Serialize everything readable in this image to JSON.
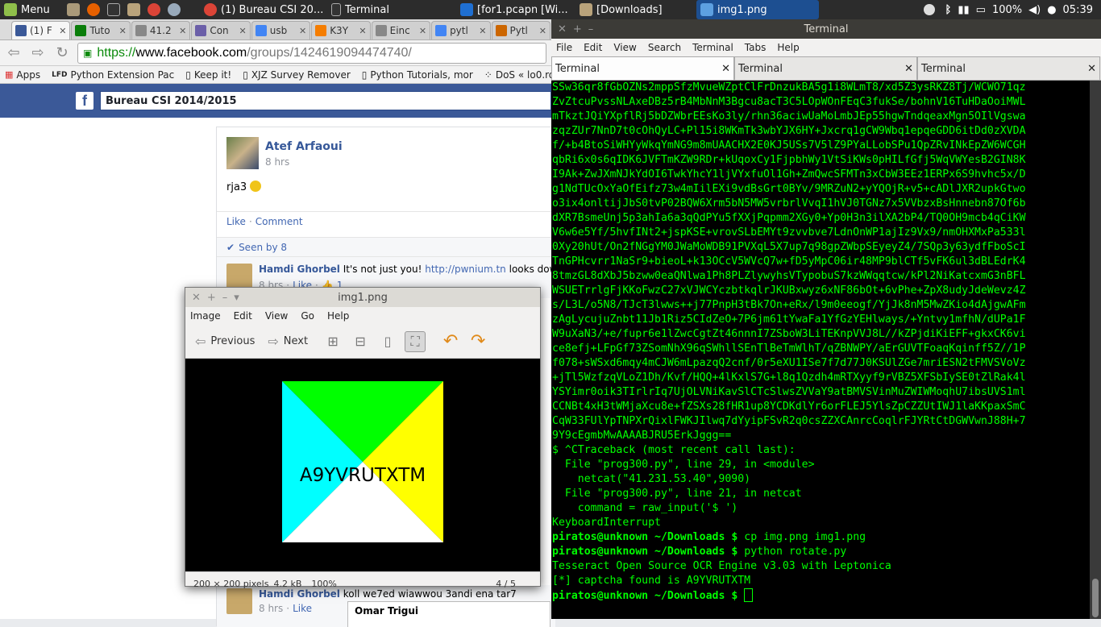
{
  "panel": {
    "menu_label": "Menu",
    "items": [
      {
        "label": "(1) Bureau CSI 20...",
        "icon": "chrome-icon"
      },
      {
        "label": "Terminal",
        "icon": "terminal-icon"
      },
      {
        "label": "[for1.pcapng",
        "icon": "wireshark-icon"
      },
      {
        "label": "[Wi...",
        "icon": "window-icon"
      },
      {
        "label": "[Downloads]",
        "icon": "folder-icon"
      },
      {
        "label": "img1.png",
        "icon": "image-viewer-icon"
      }
    ],
    "battery": "100%",
    "clock": "05:39"
  },
  "browser": {
    "tabs": [
      {
        "label": "(1) F",
        "color": "#3b5998"
      },
      {
        "label": "Tuto",
        "color": "#0a7d0a"
      },
      {
        "label": "41.2",
        "color": "#888888"
      },
      {
        "label": "Con",
        "color": "#6b5fa8"
      },
      {
        "label": "usb",
        "color": "#4285f4"
      },
      {
        "label": "K3Y",
        "color": "#f57d00"
      },
      {
        "label": "Einc",
        "color": "#888888"
      },
      {
        "label": "pytl",
        "color": "#4285f4"
      },
      {
        "label": "Pytl",
        "color": "#cc6600"
      }
    ],
    "url": {
      "scheme": "https://",
      "host": "www.facebook.com",
      "path": "/groups/1424619094474740/"
    },
    "bookmarks": [
      "Apps",
      "Python Extension Pac",
      "Keep it!",
      "XJZ Survey Remover",
      "Python Tutorials, mor",
      "DoS « lo0.ro"
    ],
    "group_title": "Bureau CSI 2014/2015"
  },
  "feed": {
    "post": {
      "author": "Atef Arfaoui",
      "time": "8 hrs",
      "text": "rja3",
      "like": "Like",
      "comment": "Comment",
      "seen": "Seen by 8"
    },
    "comments": [
      {
        "author": "Hamdi Ghorbel",
        "text": "It's not just you!",
        "link": "http://pwnium.tn",
        "tail": "looks down from he",
        "time": "8 hrs",
        "like": "Like",
        "likes": "1"
      },
      {
        "author": "Hamdi Ghorbel",
        "text": "koll we7ed wiawwou 3andi ena tar7",
        "time": "8 hrs",
        "like": "Like"
      }
    ],
    "chat_name": "Omar Trigui"
  },
  "terminal": {
    "title": "Terminal",
    "menu": [
      "File",
      "Edit",
      "View",
      "Search",
      "Terminal",
      "Tabs",
      "Help"
    ],
    "tabs": [
      "Terminal",
      "Terminal",
      "Terminal"
    ],
    "lines": [
      "SSw36qr8fGbOZNs2mppSfzMvueWZptClFrDnzukBA5g1i8WLmT8/xd5Z3ysRKZ8Tj/WCWO71qz",
      "ZvZtcuPvssNLAxeDBz5rB4MbNnM3Bgcu8acT3C5LOpWOnFEqC3fukSe/bohnV16TuHDaOoiMWL",
      "mTkztJQiYXpflRj5bDZWbrEEsKo3ly/rhn36aciwUaMoLmbJEp55hgwTndqeaxMgn5OIlVgswa",
      "zqzZUr7NnD7t0cOhQyLC+Pl15i8WKmTk3wbYJX6HY+Jxcrq1gCW9Wbq1epqeGDD6itDd0zXVDA",
      "f/+b4BtoSiWHYyWkqYmNG9m8mUAACHX2E0KJ5USs7V5lZ9PYaLLobSPu1QpZRvINkEpZW6WCGH",
      "qbRi6x0s6qIDK6JVFTmKZW9RDr+kUqoxCy1FjpbhWy1VtSiKWs0pHILfGfj5WqVWYesB2GIN8K",
      "I9Ak+ZwJXmNJkYdOI6TwkYhcY1ljVYxfuOl1Gh+ZmQwcSFMTn3xCbW3EEz1ERPx6S9hvhc5x/D",
      "g1NdTUcOxYaOfEifz73w4mIilEXi9vdBsGrt0BYv/9MRZuN2+yYQOjR+v5+cADlJXR2upkGtwo",
      "o3ix4onltijJbS0tvP02BQW6Xrm5bN5MW5vrbrlVvqI1hVJ0TGNz7x5VVbzxBsHnnebn87Of6b",
      "dXR7BsmeUnj5p3ahIa6a3qQdPYu5fXXjPqpmm2XGy0+Yp0H3n3ilXA2bP4/TQ0OH9mcb4qCiKW",
      "V6w6e5Yf/5hvfINt2+jspKSE+vrovSLbEMYt9zvvbve7LdnOnWP1ajIz9Vx9/nmOHXMxPa533l",
      "0Xy20hUt/On2fNGgYM0JWaMoWDB91PVXqL5X7up7q98gpZWbpSEyeyZ4/7SQp3y63ydfFboScI",
      "TnGPHcvrr1NaSr9+bieoL+k13OCcV5WVcQ7w+fD5yMpC06ir48MP9blCTf5vFK6ul3dBLEdrK4",
      "8tmzGL8dXbJ5bzww0eaQNlwa1Ph8PLZlywyhsVTypobuS7kzWWqqtcw/kPl2NiKatcxmG3nBFL",
      "WSUETrrlgFjKKoFwzC27xVJWCYczbtkqlrJKUBxwyz6xNF86bOt+6vPhe+ZpX8udyJdeWevz4Z",
      "s/L3L/o5N8/TJcT3lwws++j77PnpH3tBk7On+eRx/l9m0eeogf/YjJk8nM5MwZKio4dAjgwAFm",
      "zAgLycujuZnbt11Jb1Riz5CIdZeO+7P6jm61tYwaFa1YfGzYEHlways/+Yntvy1mfhN/dUPa1F",
      "W9uXaN3/+e/fupr6e1lZwcCgtZt46nnnI7ZSboW3LiTEKnpVVJ8L//kZPjdiKiEFF+gkxCK6vi",
      "ce8efj+LFpGf73ZSomNhX96qSWhllSEnTlBeTmWlhT/qZBNWPY/aErGUVTFoaqKqinff5Z//1P",
      "f078+sWSxd6mqy4mCJW6mLpazqQ2cnf/0r5eXU1ISe7f7d77J0KSUlZGe7mriESN2tFMVSVoVz",
      "+jTl5WzfzqVLoZ1Dh/Kvf/HQQ+4lKxlS7G+l8q1Qzdh4mRTXyyf9rVBZ5XFSbIySE0tZlRak4l",
      "YSYimr0oik3TIrlrIq7UjOLVNiKavSlCTcSlwsZVVaY9atBMVSVinMuZWIWMoqhU7ibsUVS1ml",
      "CCNBt4xH3tWMjaXcu8e+fZSXs28fHR1up8YCDKdlYr6orFLEJ5YlsZpCZZUtIWJ1laKKpaxSmC",
      "CqW33FUlYpTNPXrQixlFWKJIlwq7dYyipFSvR2q0csZZXCAnrcCoqlrFJYRtCtDGWVwnJ88H+7",
      "9Y9cEgmbMwAAAABJRU5ErkJggg==",
      "$ ^CTraceback (most recent call last):",
      "  File \"prog300.py\", line 29, in <module>",
      "    netcat(\"41.231.53.40\",9090)",
      "  File \"prog300.py\", line 21, in netcat",
      "    command = raw_input('$ ')",
      "KeyboardInterrupt"
    ],
    "prompt": {
      "user": "piratos@unknown",
      "path": "~/Downloads",
      "sym": "$"
    },
    "cmd1": "cp img.png img1.png",
    "cmd2": "python rotate.py",
    "out1": "Tesseract Open Source OCR Engine v3.03 with Leptonica",
    "out2": "[*] captcha found is A9YVRUTXTM"
  },
  "viewer": {
    "title": "img1.png",
    "menu": [
      "Image",
      "Edit",
      "View",
      "Go",
      "Help"
    ],
    "prev": "Previous",
    "next": "Next",
    "captcha_text": "A9YVRUTXTM",
    "colors": {
      "top": "#00ff00",
      "left": "#00ffff",
      "right": "#ffff00",
      "bottom": "#ffffff"
    },
    "status": {
      "dims": "200 × 200 pixels",
      "size": "4.2 kB",
      "zoom": "100%",
      "index": "4 / 5"
    }
  }
}
